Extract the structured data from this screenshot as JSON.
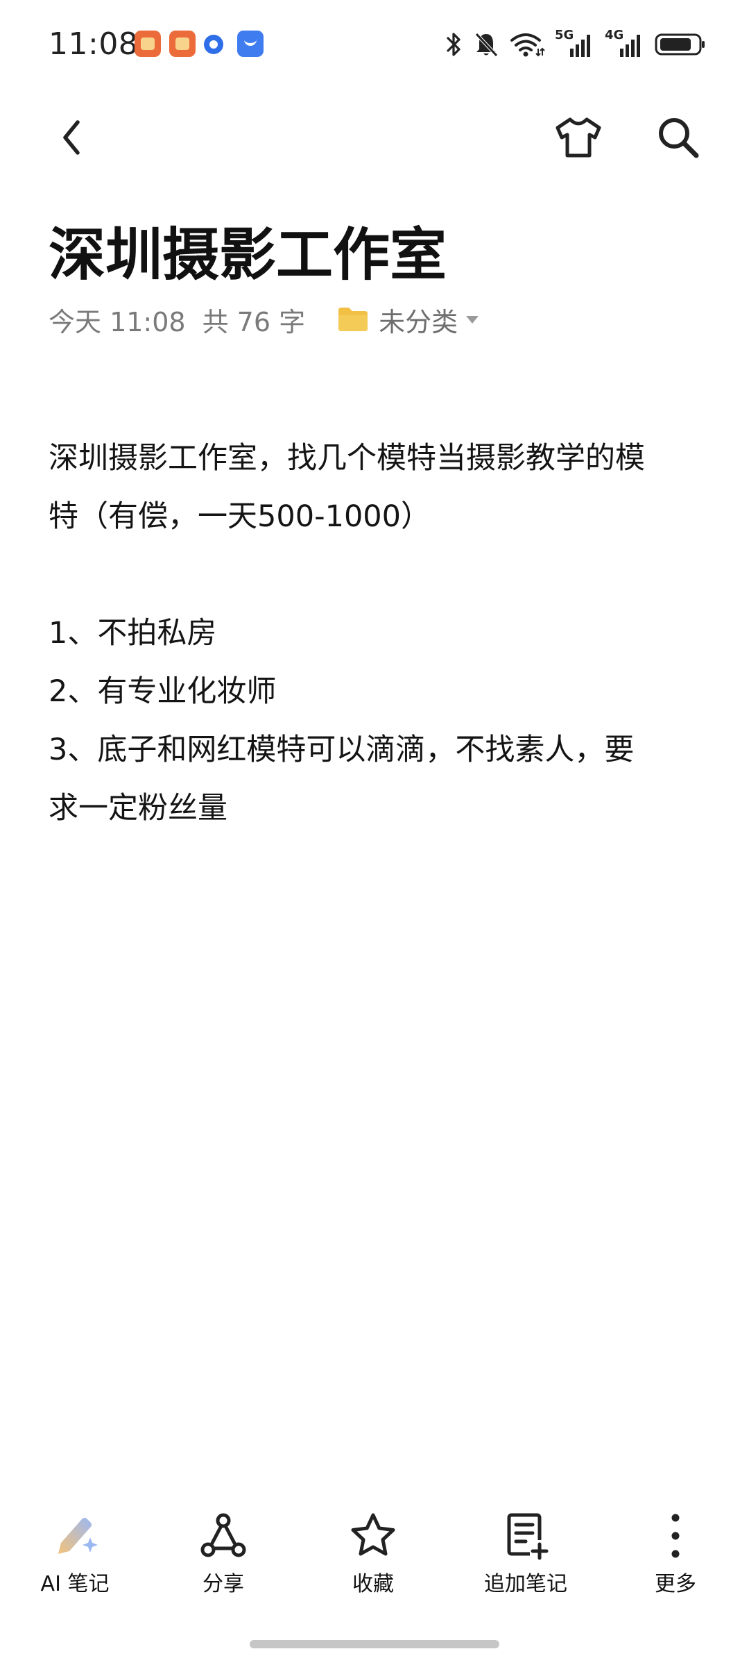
{
  "status_bar": {
    "time": "11:08",
    "network_5g": "5G",
    "network_4g": "4G"
  },
  "note": {
    "title": "深圳摄影工作室",
    "date": "今天 11:08",
    "word_count": "共 76 字",
    "folder": "未分类",
    "body_lines": [
      "深圳摄影工作室，找几个模特当摄影教学的模",
      "特（有偿，一天500-1000）",
      "",
      "1、不拍私房",
      "2、有专业化妆师",
      "3、底子和网红模特可以滴滴，不找素人，要",
      "求一定粉丝量"
    ]
  },
  "bottom_bar": {
    "ai_note": "AI 笔记",
    "share": "分享",
    "favorite": "收藏",
    "append_note": "追加笔记",
    "more": "更多"
  },
  "colors": {
    "folder": "#f2c044",
    "ai_icon_start": "#f3c27a",
    "ai_icon_end": "#9cb8f2"
  }
}
